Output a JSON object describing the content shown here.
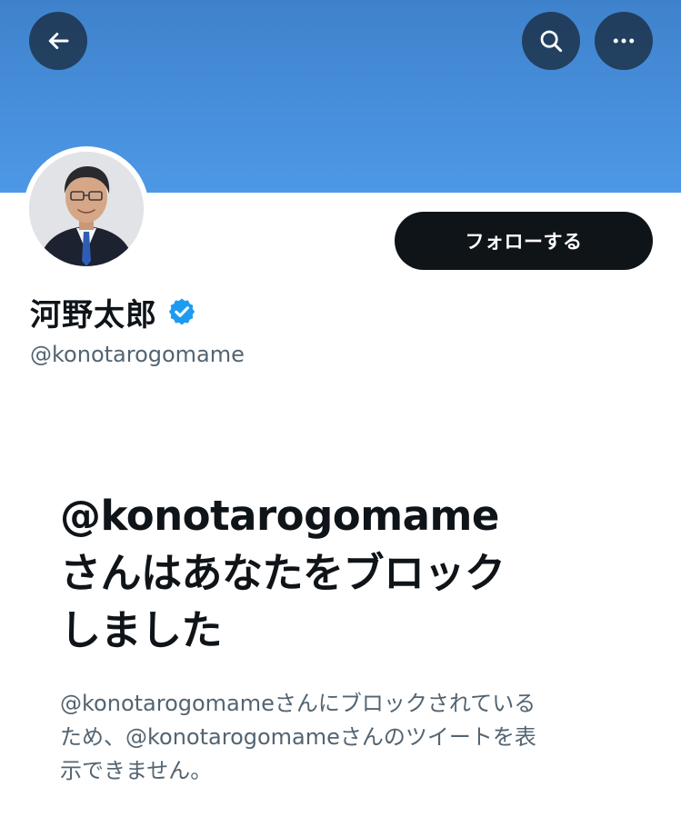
{
  "header": {
    "back_icon": "arrow-left-icon",
    "search_icon": "search-icon",
    "more_icon": "more-horizontal-icon",
    "banner_color": "#4a90e2"
  },
  "profile": {
    "display_name": "河野太郎",
    "verified_icon": "verified-badge-icon",
    "verified_color": "#1d9bf0",
    "handle": "@konotarogomame"
  },
  "actions": {
    "follow_label": "フォローする"
  },
  "blocked_notice": {
    "title_lines": [
      "@konotarogomame",
      "さんはあなたをブロック",
      "しました"
    ],
    "description_lines": [
      "@konotarogomameさんにブロックされている",
      "ため、@konotarogomameさんのツイートを表",
      "示できません。"
    ]
  }
}
